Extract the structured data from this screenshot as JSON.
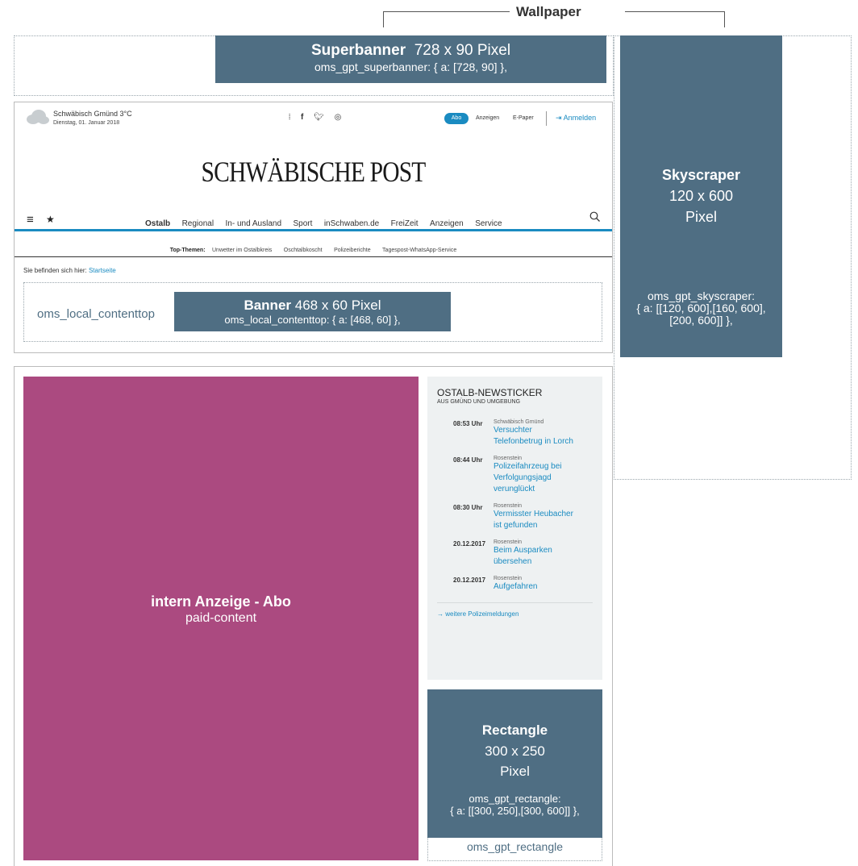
{
  "wallpaper": {
    "label": "Wallpaper"
  },
  "superbanner": {
    "title": "Superbanner",
    "size": "728 x 90 Pixel",
    "code": "oms_gpt_superbanner: { a: [728, 90] },"
  },
  "skyscraper": {
    "title": "Skyscraper",
    "size_line1": "120 x 600",
    "size_line2": "Pixel",
    "code_line1": "oms_gpt_skyscraper:",
    "code_line2": "{ a: [[120, 600],[160, 600],",
    "code_line3": "[200, 600]] },"
  },
  "header": {
    "location": "Schwäbisch Gmünd 3°C",
    "date": "Dienstag, 01. Januar 2018",
    "abo_label": "Abo",
    "anzeigen_label": "Anzeigen",
    "epaper_label": "E-Paper",
    "login_label": "Anmelden",
    "logo": "SCHWÄBISCHE POST",
    "nav": [
      "Ostalb",
      "Regional",
      "In- und Ausland",
      "Sport",
      "inSchwaben.de",
      "FreiZeit",
      "Anzeigen",
      "Service"
    ],
    "top_themes_label": "Top-Themen:",
    "top_themes": [
      "Unwetter im Ostalbkreis",
      "Oschtalbkoscht",
      "Polizeiberichte",
      "Tagespost-WhatsApp-Service"
    ],
    "breadcrumb_label": "Sie befinden sich hier:",
    "breadcrumb_link": "Startseite"
  },
  "contenttop": {
    "label": "oms_local_contenttop",
    "banner_title": "Banner",
    "banner_size": "468 x 60 Pixel",
    "banner_code": "oms_local_contenttop: { a: [468, 60] },"
  },
  "paid_content": {
    "title": "intern Anzeige - Abo",
    "subtitle": "paid-content"
  },
  "newsticker": {
    "title": "OSTALB-NEWSTICKER",
    "subtitle": "AUS GMÜND UND UMGEBUNG",
    "entries": [
      {
        "time": "08:53 Uhr",
        "place": "Schwäbisch Gmünd",
        "headline": "Versuchter Telefonbetrug in Lorch"
      },
      {
        "time": "08:44 Uhr",
        "place": "Rosenstein",
        "headline": "Polizeifahrzeug bei Verfolgungsjagd verunglückt"
      },
      {
        "time": "08:30 Uhr",
        "place": "Rosenstein",
        "headline": "Vermisster Heubacher ist gefunden"
      },
      {
        "time": "20.12.2017",
        "place": "Rosenstein",
        "headline": "Beim Ausparken übersehen"
      },
      {
        "time": "20.12.2017",
        "place": "Rosenstein",
        "headline": "Aufgefahren"
      }
    ],
    "more_link": "weitere Polizeimeldungen"
  },
  "rectangle": {
    "title": "Rectangle",
    "size_line1": "300 x 250",
    "size_line2": "Pixel",
    "code_line1": "oms_gpt_rectangle:",
    "code_line2": "{ a: [[300, 250],[300, 600]] },",
    "label": "oms_gpt_rectangle"
  },
  "colors": {
    "ad_slate": "#4f6e83",
    "paid_magenta": "#ab4a80",
    "accent_blue": "#1a8bc1"
  }
}
